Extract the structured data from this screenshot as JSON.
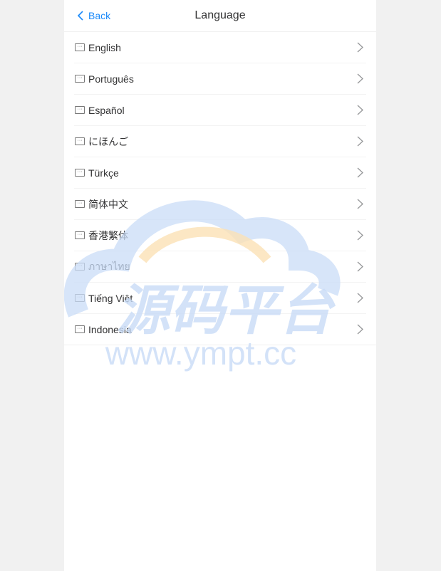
{
  "header": {
    "back_label": "Back",
    "title": "Language"
  },
  "languages": [
    "English",
    "Português",
    "Español",
    "にほんご",
    "Türkçe",
    "简体中文",
    "香港繁体",
    "ภาษาไทย",
    "Tiếng Việt",
    "Indonesia"
  ],
  "watermark": {
    "main": "源码平台",
    "url": "www.ympt.cc"
  },
  "colors": {
    "accent": "#1989fa",
    "watermark_blue": "#c9dcf7",
    "watermark_orange": "#fbe1b5"
  }
}
